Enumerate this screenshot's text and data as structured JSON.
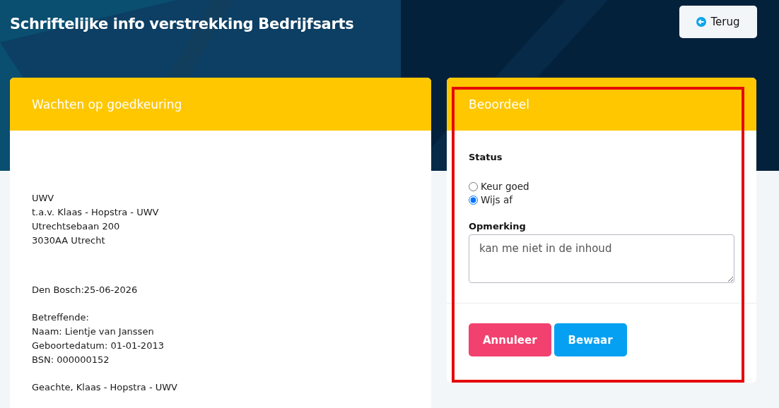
{
  "page": {
    "title": "Schriftelijke info verstrekking Bedrijfsarts",
    "back_button": "Terug"
  },
  "letter_card": {
    "title": "Wachten op goedkeuring",
    "paragraphs": [
      [
        "UWV",
        "t.a.v. Klaas - Hopstra - UWV",
        "Utrechtsebaan 200",
        "3030AA Utrecht"
      ],
      [
        "Den Bosch:25-06-2026"
      ],
      [
        "Betreffende:",
        "Naam: Lientje van Janssen",
        "Geboortedatum:  01-01-2013",
        "BSN: 000000152"
      ],
      [
        "Geachte, Klaas - Hopstra - UWV"
      ]
    ]
  },
  "review_card": {
    "title": "Beoordeel",
    "highlighted": true,
    "status_label": "Status",
    "options": [
      {
        "label": "Keur goed",
        "selected": false
      },
      {
        "label": "Wijs af",
        "selected": true
      }
    ],
    "remark_label": "Opmerking",
    "remark_value": "kan me niet in de inhoud",
    "buttons": [
      {
        "label": "Annuleer",
        "kind": "cancel"
      },
      {
        "label": "Bewaar",
        "kind": "save"
      }
    ]
  }
}
